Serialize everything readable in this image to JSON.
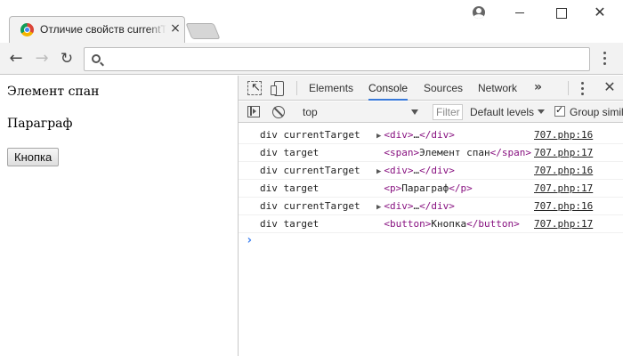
{
  "browser": {
    "tab_title": "Отличие свойств currentTarget",
    "tab_close": "×",
    "window_close": "✕",
    "address": ""
  },
  "page": {
    "span_text": "Элемент спан",
    "paragraph_text": "Параграф",
    "button_label": "Кнопка"
  },
  "devtools": {
    "tabs": [
      {
        "label": "Elements",
        "active": false
      },
      {
        "label": "Console",
        "active": true
      },
      {
        "label": "Sources",
        "active": false
      },
      {
        "label": "Network",
        "active": false
      }
    ],
    "more": "»",
    "close": "✕",
    "context": "top",
    "filter_placeholder": "Filter",
    "levels": "Default levels",
    "group_similar": "Group similar",
    "prompt": "›",
    "logs": [
      {
        "label": "div currentTarget",
        "open": "<div>",
        "text": "…",
        "close": "</div>",
        "collapsed": true,
        "source": "707.php:16"
      },
      {
        "label": "div target",
        "open": "<span>",
        "text": "Элемент спан",
        "close": "</span>",
        "collapsed": false,
        "source": "707.php:17"
      },
      {
        "label": "div currentTarget",
        "open": "<div>",
        "text": "…",
        "close": "</div>",
        "collapsed": true,
        "source": "707.php:16"
      },
      {
        "label": "div target",
        "open": "<p>",
        "text": "Параграф",
        "close": "</p>",
        "collapsed": false,
        "source": "707.php:17"
      },
      {
        "label": "div currentTarget",
        "open": "<div>",
        "text": "…",
        "close": "</div>",
        "collapsed": true,
        "source": "707.php:16"
      },
      {
        "label": "div target",
        "open": "<button>",
        "text": "Кнопка",
        "close": "</button>",
        "collapsed": false,
        "source": "707.php:17"
      }
    ]
  }
}
